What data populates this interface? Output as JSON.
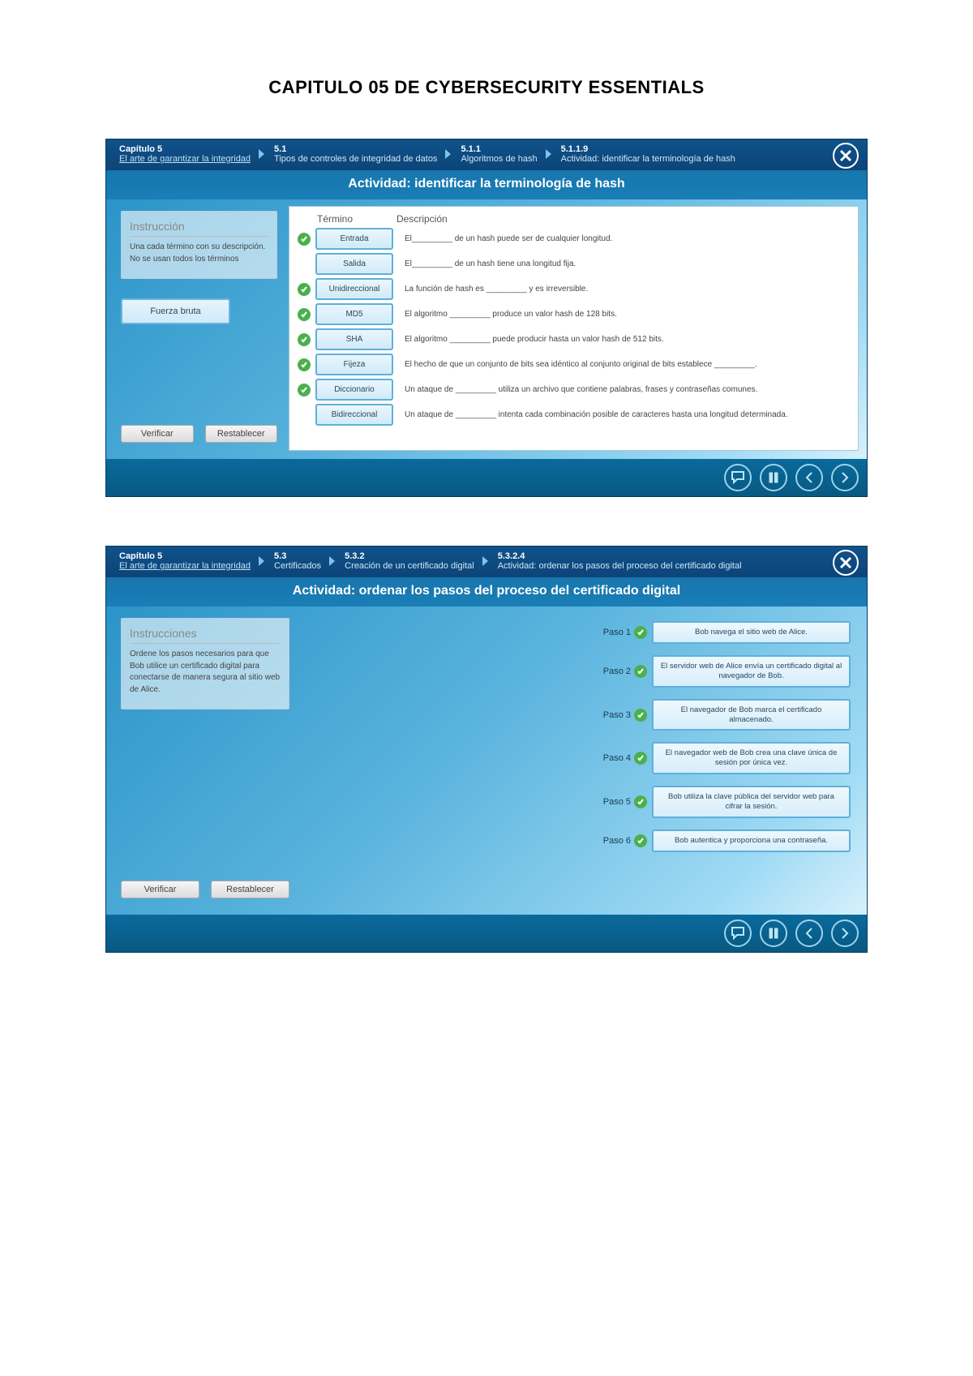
{
  "page_title": "CAPITULO 05 DE CYBERSECURITY ESSENTIALS",
  "module1": {
    "breadcrumb": [
      {
        "num": "Capítulo 5",
        "txt": "El arte de garantizar la integridad",
        "link": true
      },
      {
        "num": "5.1",
        "txt": "Tipos de controles de integridad de datos"
      },
      {
        "num": "5.1.1",
        "txt": "Algoritmos de hash"
      },
      {
        "num": "5.1.1.9",
        "txt": "Actividad: identificar la terminología de hash"
      }
    ],
    "activity_title": "Actividad: identificar la terminología de hash",
    "instr_title": "Instrucción",
    "instr_text": "Una cada término con su descripción. No se usan todos los términos",
    "drag_term": "Fuerza bruta",
    "verify": "Verificar",
    "reset": "Restablecer",
    "col_term": "Término",
    "col_desc": "Descripción",
    "rows": [
      {
        "tick": true,
        "term": "Entrada",
        "desc": "El_________ de un hash puede ser de cualquier longitud."
      },
      {
        "tick": false,
        "term": "Salida",
        "desc": "El_________ de un hash tiene una longitud fija."
      },
      {
        "tick": true,
        "term": "Unidireccional",
        "desc": "La función de hash es _________ y es irreversible."
      },
      {
        "tick": true,
        "term": "MD5",
        "desc": "El algoritmo _________ produce un valor hash de 128 bits."
      },
      {
        "tick": true,
        "term": "SHA",
        "desc": "El algoritmo _________ puede producir hasta un valor hash de 512 bits."
      },
      {
        "tick": true,
        "term": "Fijeza",
        "desc": "El hecho de que un conjunto de bits sea idéntico al conjunto original de bits establece _________."
      },
      {
        "tick": true,
        "term": "Diccionario",
        "desc": "Un ataque de _________ utiliza un archivo que contiene palabras, frases y contraseñas comunes."
      },
      {
        "tick": false,
        "term": "Bidireccional",
        "desc": "Un ataque de _________ intenta cada combinación posible de caracteres hasta una longitud determinada."
      }
    ]
  },
  "module2": {
    "breadcrumb": [
      {
        "num": "Capítulo 5",
        "txt": "El arte de garantizar la integridad",
        "link": true
      },
      {
        "num": "5.3",
        "txt": "Certificados"
      },
      {
        "num": "5.3.2",
        "txt": "Creación de un certificado digital"
      },
      {
        "num": "5.3.2.4",
        "txt": "Actividad: ordenar los pasos del proceso del certificado digital"
      }
    ],
    "activity_title": "Actividad: ordenar los pasos del proceso del certificado digital",
    "instr_title": "Instrucciones",
    "instr_text": "Ordene los pasos necesarios para que Bob utilice un certificado digital para conectarse de manera segura al sitio web de Alice.",
    "verify": "Verificar",
    "reset": "Restablecer",
    "steps": [
      {
        "label": "Paso 1",
        "text": "Bob navega el sitio web de Alice."
      },
      {
        "label": "Paso 2",
        "text": "El servidor web de Alice envía un certificado digital al navegador de Bob."
      },
      {
        "label": "Paso 3",
        "text": "El navegador de Bob marca el certificado almacenado."
      },
      {
        "label": "Paso 4",
        "text": "El navegador web de Bob crea una clave única de sesión por única vez."
      },
      {
        "label": "Paso 5",
        "text": "Bob utiliza la clave pública del servidor web para cifrar la sesión."
      },
      {
        "label": "Paso 6",
        "text": "Bob autentica y proporciona una contraseña."
      }
    ]
  }
}
